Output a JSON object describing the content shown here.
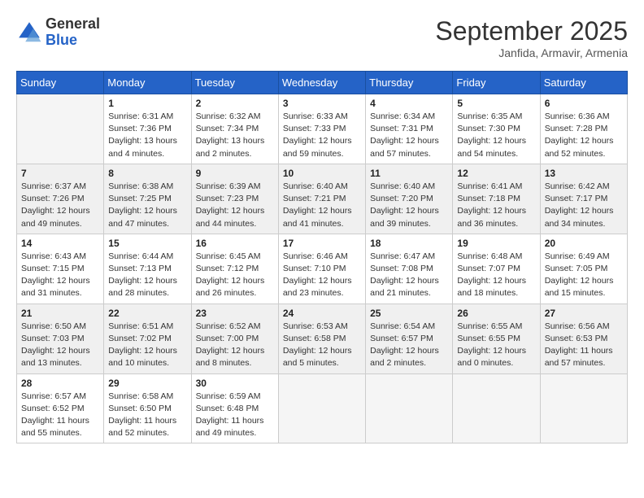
{
  "header": {
    "logo_general": "General",
    "logo_blue": "Blue",
    "month_title": "September 2025",
    "location": "Janfida, Armavir, Armenia"
  },
  "days_of_week": [
    "Sunday",
    "Monday",
    "Tuesday",
    "Wednesday",
    "Thursday",
    "Friday",
    "Saturday"
  ],
  "weeks": [
    [
      {
        "day": "",
        "info": ""
      },
      {
        "day": "1",
        "info": "Sunrise: 6:31 AM\nSunset: 7:36 PM\nDaylight: 13 hours\nand 4 minutes."
      },
      {
        "day": "2",
        "info": "Sunrise: 6:32 AM\nSunset: 7:34 PM\nDaylight: 13 hours\nand 2 minutes."
      },
      {
        "day": "3",
        "info": "Sunrise: 6:33 AM\nSunset: 7:33 PM\nDaylight: 12 hours\nand 59 minutes."
      },
      {
        "day": "4",
        "info": "Sunrise: 6:34 AM\nSunset: 7:31 PM\nDaylight: 12 hours\nand 57 minutes."
      },
      {
        "day": "5",
        "info": "Sunrise: 6:35 AM\nSunset: 7:30 PM\nDaylight: 12 hours\nand 54 minutes."
      },
      {
        "day": "6",
        "info": "Sunrise: 6:36 AM\nSunset: 7:28 PM\nDaylight: 12 hours\nand 52 minutes."
      }
    ],
    [
      {
        "day": "7",
        "info": "Sunrise: 6:37 AM\nSunset: 7:26 PM\nDaylight: 12 hours\nand 49 minutes."
      },
      {
        "day": "8",
        "info": "Sunrise: 6:38 AM\nSunset: 7:25 PM\nDaylight: 12 hours\nand 47 minutes."
      },
      {
        "day": "9",
        "info": "Sunrise: 6:39 AM\nSunset: 7:23 PM\nDaylight: 12 hours\nand 44 minutes."
      },
      {
        "day": "10",
        "info": "Sunrise: 6:40 AM\nSunset: 7:21 PM\nDaylight: 12 hours\nand 41 minutes."
      },
      {
        "day": "11",
        "info": "Sunrise: 6:40 AM\nSunset: 7:20 PM\nDaylight: 12 hours\nand 39 minutes."
      },
      {
        "day": "12",
        "info": "Sunrise: 6:41 AM\nSunset: 7:18 PM\nDaylight: 12 hours\nand 36 minutes."
      },
      {
        "day": "13",
        "info": "Sunrise: 6:42 AM\nSunset: 7:17 PM\nDaylight: 12 hours\nand 34 minutes."
      }
    ],
    [
      {
        "day": "14",
        "info": "Sunrise: 6:43 AM\nSunset: 7:15 PM\nDaylight: 12 hours\nand 31 minutes."
      },
      {
        "day": "15",
        "info": "Sunrise: 6:44 AM\nSunset: 7:13 PM\nDaylight: 12 hours\nand 28 minutes."
      },
      {
        "day": "16",
        "info": "Sunrise: 6:45 AM\nSunset: 7:12 PM\nDaylight: 12 hours\nand 26 minutes."
      },
      {
        "day": "17",
        "info": "Sunrise: 6:46 AM\nSunset: 7:10 PM\nDaylight: 12 hours\nand 23 minutes."
      },
      {
        "day": "18",
        "info": "Sunrise: 6:47 AM\nSunset: 7:08 PM\nDaylight: 12 hours\nand 21 minutes."
      },
      {
        "day": "19",
        "info": "Sunrise: 6:48 AM\nSunset: 7:07 PM\nDaylight: 12 hours\nand 18 minutes."
      },
      {
        "day": "20",
        "info": "Sunrise: 6:49 AM\nSunset: 7:05 PM\nDaylight: 12 hours\nand 15 minutes."
      }
    ],
    [
      {
        "day": "21",
        "info": "Sunrise: 6:50 AM\nSunset: 7:03 PM\nDaylight: 12 hours\nand 13 minutes."
      },
      {
        "day": "22",
        "info": "Sunrise: 6:51 AM\nSunset: 7:02 PM\nDaylight: 12 hours\nand 10 minutes."
      },
      {
        "day": "23",
        "info": "Sunrise: 6:52 AM\nSunset: 7:00 PM\nDaylight: 12 hours\nand 8 minutes."
      },
      {
        "day": "24",
        "info": "Sunrise: 6:53 AM\nSunset: 6:58 PM\nDaylight: 12 hours\nand 5 minutes."
      },
      {
        "day": "25",
        "info": "Sunrise: 6:54 AM\nSunset: 6:57 PM\nDaylight: 12 hours\nand 2 minutes."
      },
      {
        "day": "26",
        "info": "Sunrise: 6:55 AM\nSunset: 6:55 PM\nDaylight: 12 hours\nand 0 minutes."
      },
      {
        "day": "27",
        "info": "Sunrise: 6:56 AM\nSunset: 6:53 PM\nDaylight: 11 hours\nand 57 minutes."
      }
    ],
    [
      {
        "day": "28",
        "info": "Sunrise: 6:57 AM\nSunset: 6:52 PM\nDaylight: 11 hours\nand 55 minutes."
      },
      {
        "day": "29",
        "info": "Sunrise: 6:58 AM\nSunset: 6:50 PM\nDaylight: 11 hours\nand 52 minutes."
      },
      {
        "day": "30",
        "info": "Sunrise: 6:59 AM\nSunset: 6:48 PM\nDaylight: 11 hours\nand 49 minutes."
      },
      {
        "day": "",
        "info": ""
      },
      {
        "day": "",
        "info": ""
      },
      {
        "day": "",
        "info": ""
      },
      {
        "day": "",
        "info": ""
      }
    ]
  ]
}
